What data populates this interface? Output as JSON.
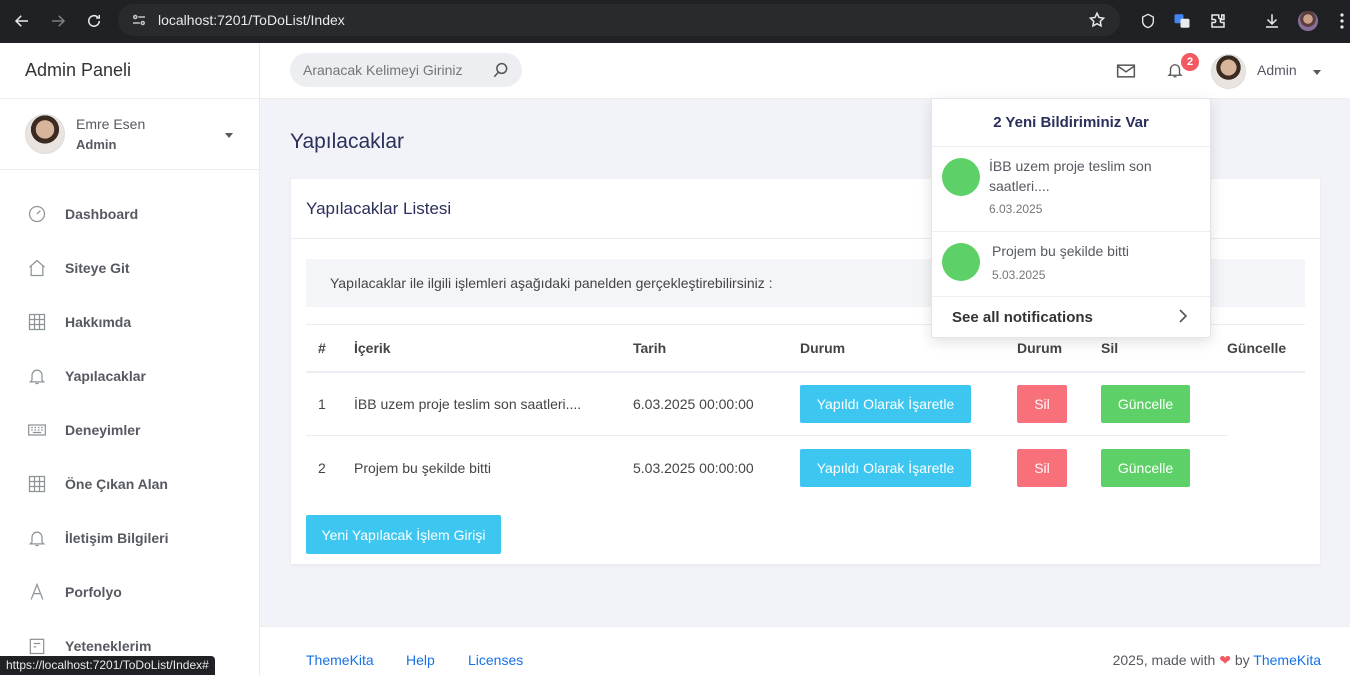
{
  "browser": {
    "url": "localhost:7201/ToDoList/Index",
    "status_url": "https://localhost:7201/ToDoList/Index#"
  },
  "sidebar": {
    "brand": "Admin Paneli",
    "user_name": "Emre Esen",
    "user_role": "Admin",
    "items": [
      {
        "label": "Dashboard",
        "icon": "gauge-icon"
      },
      {
        "label": "Siteye Git",
        "icon": "home-icon"
      },
      {
        "label": "Hakkımda",
        "icon": "grid-icon"
      },
      {
        "label": "Yapılacaklar",
        "icon": "bell-icon"
      },
      {
        "label": "Deneyimler",
        "icon": "keyboard-icon"
      },
      {
        "label": "Öne Çıkan Alan",
        "icon": "grid-icon"
      },
      {
        "label": "İletişim Bilgileri",
        "icon": "bell-icon"
      },
      {
        "label": "Porfolyo",
        "icon": "letter-a-icon"
      },
      {
        "label": "Yeteneklerim",
        "icon": "calendar-icon"
      }
    ]
  },
  "topbar": {
    "search_placeholder": "Aranacak Kelimeyi Giriniz",
    "notification_count": "2",
    "user_label": "Admin"
  },
  "main": {
    "page_title": "Yapılacaklar",
    "card_title": "Yapılacaklar Listesi",
    "info_text": "Yapılacaklar ile ilgili işlemleri aşağıdaki panelden gerçekleştirebilirsiniz :",
    "columns": [
      "#",
      "İçerik",
      "Tarih",
      "Durum",
      "Durum",
      "Sil",
      "Güncelle"
    ],
    "rows": [
      {
        "num": "1",
        "content": "İBB uzem proje teslim son saatleri....",
        "date": "6.03.2025 00:00:00",
        "mark": "Yapıldı Olarak İşaretle",
        "delete": "Sil",
        "update": "Güncelle"
      },
      {
        "num": "2",
        "content": "Projem bu şekilde bitti",
        "date": "5.03.2025 00:00:00",
        "mark": "Yapıldı Olarak İşaretle",
        "delete": "Sil",
        "update": "Güncelle"
      }
    ],
    "new_button": "Yeni Yapılacak İşlem Girişi"
  },
  "notifications": {
    "title": "2 Yeni Bildiriminiz Var",
    "items": [
      {
        "text_line1": "İBB uzem proje teslim son",
        "text_line2": "saatleri....",
        "date": "6.03.2025"
      },
      {
        "text_line1": "Projem bu şekilde bitti",
        "date": "5.03.2025"
      }
    ],
    "see_all": "See all notifications"
  },
  "footer": {
    "links": [
      "ThemeKita",
      "Help",
      "Licenses"
    ],
    "made_with": "2025, made with",
    "by": "by",
    "brand": "ThemeKita"
  },
  "colors": {
    "info": "#3dc7f0",
    "danger": "#f7707a",
    "success": "#5dd167",
    "badge": "#f25961",
    "link": "#1572e8"
  }
}
